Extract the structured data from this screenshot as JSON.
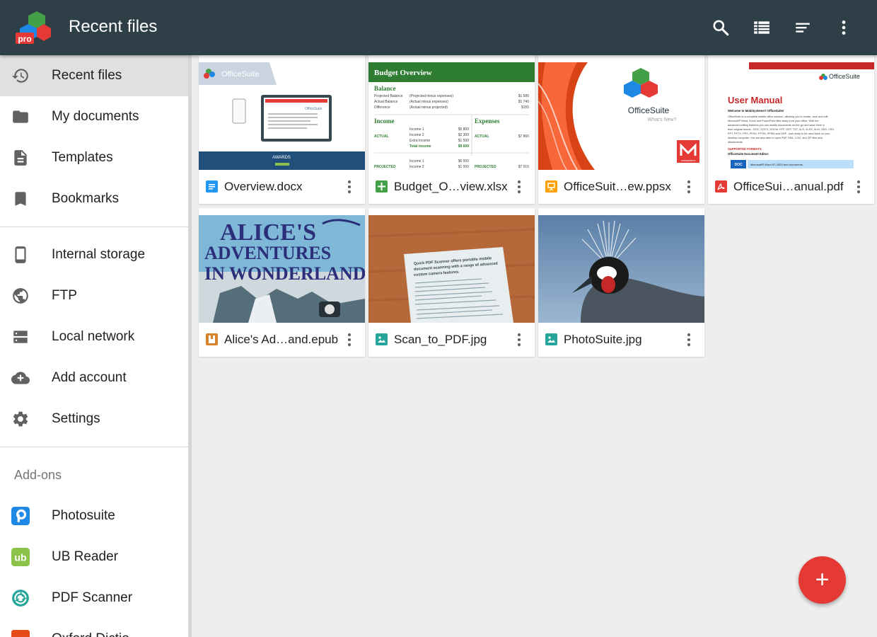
{
  "app": {
    "title": "Recent files",
    "logo_badge": "pro",
    "colors": {
      "appbar": "#2f3f48",
      "fab": "#e53935",
      "accent": "#e53935"
    }
  },
  "toolbar": {
    "icons": [
      "search-icon",
      "list-view-icon",
      "sort-icon",
      "overflow-menu-icon"
    ]
  },
  "sidebar": {
    "primary": [
      {
        "label": "Recent files",
        "icon": "history-icon",
        "active": true
      },
      {
        "label": "My documents",
        "icon": "folder-icon"
      },
      {
        "label": "Templates",
        "icon": "document-icon"
      },
      {
        "label": "Bookmarks",
        "icon": "bookmark-icon"
      }
    ],
    "locations": [
      {
        "label": "Internal storage",
        "icon": "phone-icon"
      },
      {
        "label": "FTP",
        "icon": "globe-icon"
      },
      {
        "label": "Local network",
        "icon": "network-icon"
      },
      {
        "label": "Add account",
        "icon": "cloud-add-icon"
      },
      {
        "label": "Settings",
        "icon": "gear-icon"
      }
    ],
    "addons_header": "Add-ons",
    "addons": [
      {
        "label": "Photosuite",
        "icon": "photosuite-icon"
      },
      {
        "label": "UB Reader",
        "icon": "ub-reader-icon",
        "badge": "ub"
      },
      {
        "label": "PDF Scanner",
        "icon": "pdf-scanner-icon"
      },
      {
        "label": "Oxford Dictio",
        "icon": "oxford-dictionary-icon"
      }
    ]
  },
  "files": [
    {
      "name": "Overview.docx",
      "type": "docx",
      "type_color": "#2196f3",
      "thumb": {
        "brand": "OfficeSuite",
        "banner": "AWARDS",
        "badge": "OfficeSuite"
      }
    },
    {
      "name": "Budget_O…view.xlsx",
      "type": "xlsx",
      "type_color": "#43a047",
      "thumb": {
        "title": "Budget Overview",
        "balance_heading": "Balance",
        "balance_rows": [
          {
            "label": "Projected Balance",
            "note": "(Projected  minus expenses)",
            "value": "$1 585"
          },
          {
            "label": "Actual Balance",
            "note": "(Actual  minus expenses)",
            "value": "$1 740"
          },
          {
            "label": "Difference",
            "note": "(Actual minus projected)",
            "value": "$155"
          }
        ],
        "income_heading": "Income",
        "expenses_heading": "Expenses",
        "actual_label": "ACTUAL",
        "projected_label": "PROJECTED",
        "income_rows": [
          {
            "label": "Income 1",
            "value": "$5 800"
          },
          {
            "label": "Income 2",
            "value": "$2 300"
          },
          {
            "label": "Extra income",
            "value": "$1 500"
          },
          {
            "label": "Total income",
            "value": "$9 600"
          }
        ],
        "expense_actual": "$7 860",
        "projected_rows": [
          {
            "label": "Income 1",
            "value": "$6 000"
          },
          {
            "label": "Income 2",
            "value": "$1 000"
          }
        ],
        "expense_projected": "$7 915"
      }
    },
    {
      "name": "OfficeSuit…ew.ppsx",
      "type": "ppsx",
      "type_color": "#ffa000",
      "thumb": {
        "brand": "OfficeSuite",
        "tagline": "What's New?",
        "maker": "mobisystems"
      }
    },
    {
      "name": "OfficeSui…anual.pdf",
      "type": "pdf",
      "type_color": "#e53935",
      "thumb": {
        "brand": "OfficeSuite",
        "title": "User Manual",
        "welcome": "Welcome to MobiSystems® OfficeSuite!",
        "body": [
          "OfficeSuite is a complete mobile office solution, allowing you to create, view and edit",
          "Microsoft® Word, Excel and PowerPoint files away from your office. With the",
          "advanced editing features you can modify documents on-the-go and save them in",
          "their original format - DOC, DOCX, DOCM, RTF, ODT, TXT, XLS, XLSX, XLM, ODS, CSV,",
          "PPT, PPTX, PPS, PPSX, PPTM, PPSM and ODP - just ready to be used back on your",
          "desktop computer. You are also able to open PDF, EML, LOG, and ZIP files and",
          "attachments."
        ],
        "formats_heading": "SUPPORTED FORMATS",
        "editor_heading": "OfficeSuite Document Editor:",
        "table_key": "DOC",
        "table_value": "Microsoft® Word 97-2003 text documents."
      }
    },
    {
      "name": "Alice's Ad…and.epub",
      "type": "epub",
      "type_color": "#d9822b",
      "thumb": {
        "line1": "ALICE'S",
        "line2": "ADVENTURES",
        "line3": "IN WONDERLAND"
      }
    },
    {
      "name": "Scan_to_PDF.jpg",
      "type": "jpg",
      "type_color": "#26a69a",
      "thumb": {
        "line1": "Quick PDF Scanner offers portable mobile",
        "line2": "document scanning with a range of advanced",
        "line3": "custom camera features."
      }
    },
    {
      "name": "PhotoSuite.jpg",
      "type": "jpg",
      "type_color": "#26a69a",
      "thumb": {}
    }
  ],
  "fab": {
    "label": "+"
  }
}
